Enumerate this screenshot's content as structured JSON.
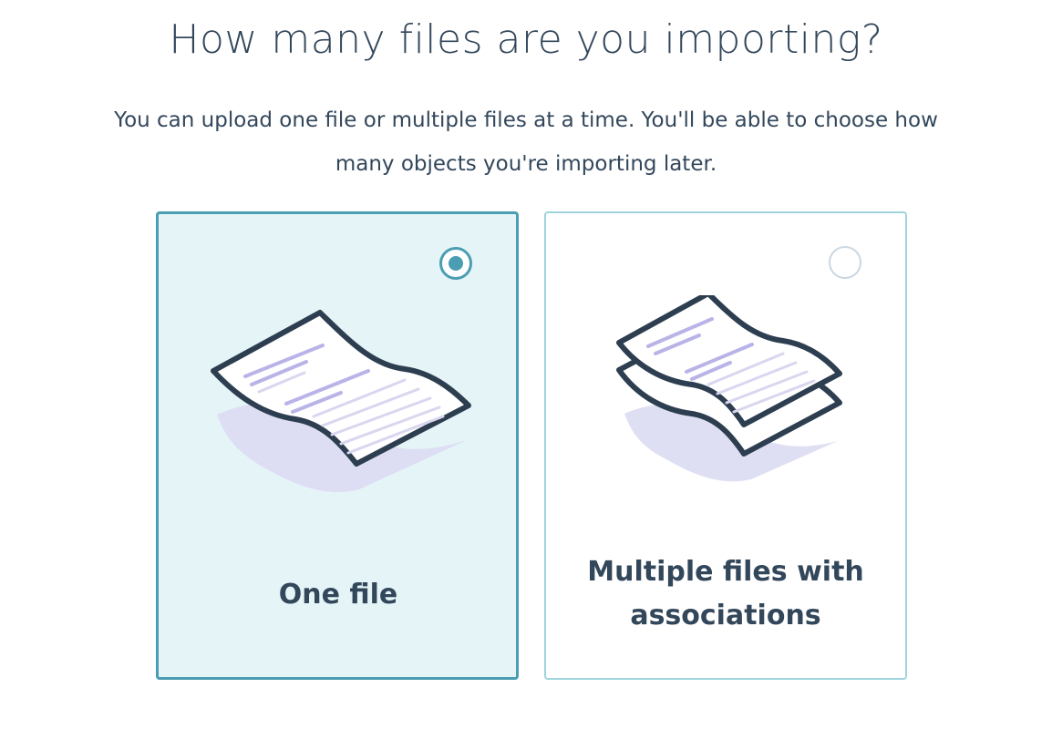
{
  "heading": "How many files are you importing?",
  "description": "You can upload one file or multiple files at a time. You'll be able to choose how many objects you're importing later.",
  "options": [
    {
      "label": "One file",
      "selected": true,
      "icon": "single-file-icon"
    },
    {
      "label": "Multiple files with associations",
      "selected": false,
      "icon": "multiple-files-icon"
    }
  ],
  "colors": {
    "accent": "#4a9db2",
    "selected_bg": "#e5f4f7",
    "unselected_border": "#9fd4de",
    "text": "#33475b",
    "illustration_stroke": "#2d3e50",
    "illustration_lines": "#b9b4e8",
    "shadow": "#dcdbf3"
  }
}
